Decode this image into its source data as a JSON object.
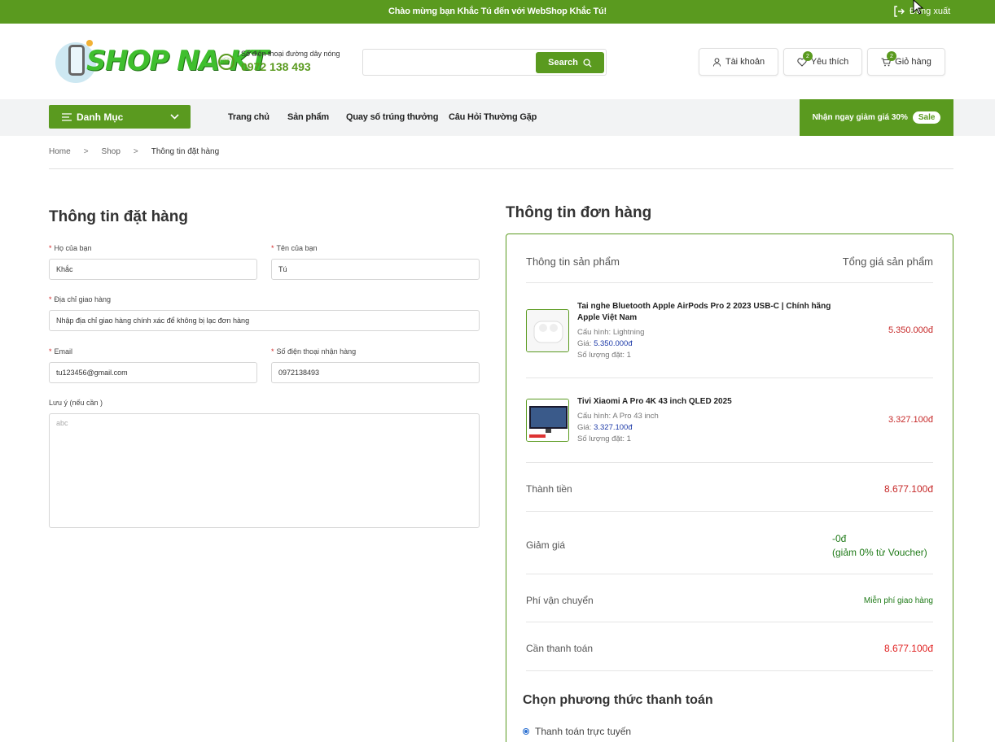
{
  "topbar": {
    "welcome": "Chào mừng bạn Khắc Tú đến với WebShop Khắc Tú!",
    "logout_label": "Đăng xuất"
  },
  "header": {
    "logo_text": "SHOP NA-KT",
    "hotline_label": "Số điện thoại đường dây nóng",
    "hotline_number": "0972 138 493",
    "search_placeholder": "",
    "search_button": "Search",
    "account_label": "Tài khoản",
    "wishlist_label": "Yêu thích",
    "wishlist_count": "2",
    "cart_label": "Giỏ hàng",
    "cart_count": "2"
  },
  "nav": {
    "category_label": "Danh Mục",
    "links": [
      "Trang chủ",
      "Sản phẩm",
      "Quay số trúng thưởng",
      "Câu Hỏi Thường Gặp"
    ],
    "promo_text": "Nhận ngay giảm giá 30%",
    "promo_badge": "Sale"
  },
  "breadcrumb": [
    "Home",
    "Shop",
    "Thông tin đặt hàng"
  ],
  "order_form": {
    "title": "Thông tin đặt hàng",
    "last_name_label": "Họ của bạn",
    "last_name_value": "Khắc",
    "first_name_label": "Tên của bạn",
    "first_name_value": "Tú",
    "address_label": "Địa chỉ giao hàng",
    "address_placeholder": "Nhập địa chỉ giao hàng chính xác để không bị lạc đơn hàng",
    "email_label": "Email",
    "email_value": "tu123456@gmail.com",
    "phone_label": "Số điện thoại nhận hàng",
    "phone_value": "0972138493",
    "note_label": "Lưu ý (nếu cần )",
    "note_placeholder": "abc"
  },
  "order_summary": {
    "title": "Thông tin đơn hàng",
    "col_product": "Thông tin sản phẩm",
    "col_total": "Tổng giá sản phẩm",
    "config_label": "Cấu hình:",
    "price_label": "Giá:",
    "qty_label": "Số lượng đặt:",
    "products": [
      {
        "name": "Tai nghe Bluetooth Apple AirPods Pro 2 2023 USB-C | Chính hãng Apple Việt Nam",
        "config": "Lightning",
        "price": "5.350.000đ",
        "qty": "1",
        "total": "5.350.000đ"
      },
      {
        "name": "Tivi Xiaomi A Pro 4K 43 inch QLED 2025",
        "config": "A Pro 43 inch",
        "price": "3.327.100đ",
        "qty": "1",
        "total": "3.327.100đ"
      }
    ],
    "subtotal_label": "Thành tiền",
    "subtotal_value": "8.677.100đ",
    "discount_label": "Giảm giá",
    "discount_value": "-0đ",
    "discount_note": "(giảm 0% từ Voucher)",
    "shipping_label": "Phí vận chuyển",
    "shipping_value": "Miễn phí giao hàng",
    "total_label": "Cần thanh toán",
    "total_value": "8.677.100đ",
    "payment_title": "Chọn phương thức thanh toán",
    "payment_option": "Thanh toán trực tuyến"
  }
}
